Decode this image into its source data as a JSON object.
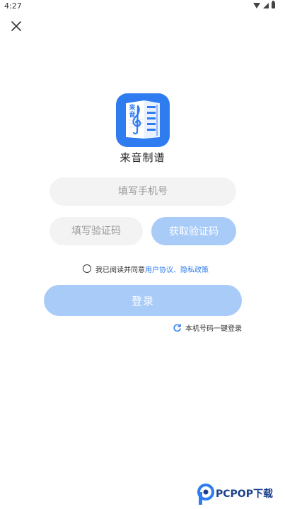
{
  "status_bar": {
    "time": "4:27"
  },
  "app": {
    "name": "来音制谱",
    "logo_text": "来音"
  },
  "form": {
    "phone_placeholder": "填写手机号",
    "code_placeholder": "填写验证码",
    "get_code_label": "获取验证码",
    "login_label": "登录"
  },
  "agreement": {
    "prefix": "我已阅读并同意",
    "user_agreement": "用户协议",
    "separator": "、",
    "privacy_policy": "隐私政策",
    "checked": false
  },
  "one_key_login": {
    "label": "本机号码一键登录"
  },
  "watermark": {
    "text": "PCPOP下载"
  },
  "colors": {
    "accent": "#2e7cf0",
    "button_disabled": "#a9cbf8",
    "field_bg": "#f3f3f4"
  },
  "icons": [
    "close-icon",
    "wifi-icon",
    "signal-icon",
    "battery-icon",
    "refresh-icon"
  ]
}
